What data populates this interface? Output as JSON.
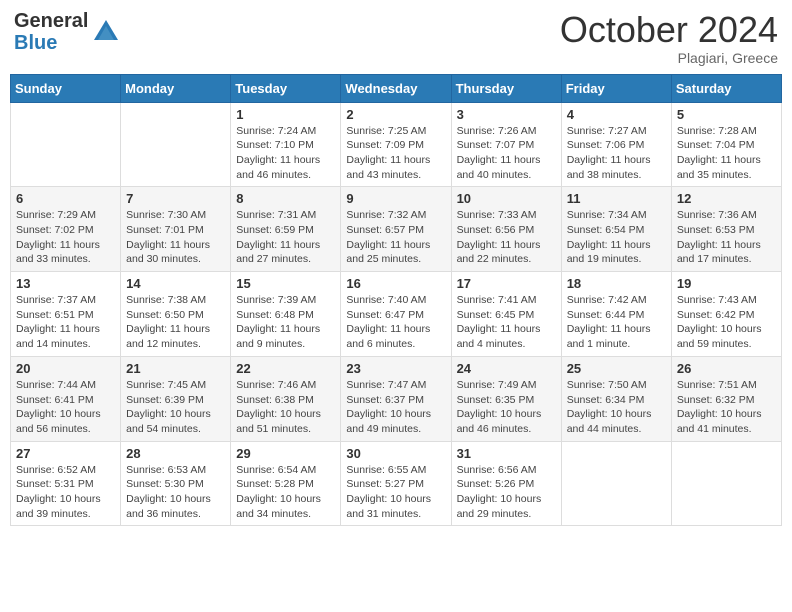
{
  "header": {
    "logo_general": "General",
    "logo_blue": "Blue",
    "month_title": "October 2024",
    "location": "Plagiari, Greece"
  },
  "days_of_week": [
    "Sunday",
    "Monday",
    "Tuesday",
    "Wednesday",
    "Thursday",
    "Friday",
    "Saturday"
  ],
  "weeks": [
    [
      {
        "day": "",
        "info": ""
      },
      {
        "day": "",
        "info": ""
      },
      {
        "day": "1",
        "info": "Sunrise: 7:24 AM\nSunset: 7:10 PM\nDaylight: 11 hours and 46 minutes."
      },
      {
        "day": "2",
        "info": "Sunrise: 7:25 AM\nSunset: 7:09 PM\nDaylight: 11 hours and 43 minutes."
      },
      {
        "day": "3",
        "info": "Sunrise: 7:26 AM\nSunset: 7:07 PM\nDaylight: 11 hours and 40 minutes."
      },
      {
        "day": "4",
        "info": "Sunrise: 7:27 AM\nSunset: 7:06 PM\nDaylight: 11 hours and 38 minutes."
      },
      {
        "day": "5",
        "info": "Sunrise: 7:28 AM\nSunset: 7:04 PM\nDaylight: 11 hours and 35 minutes."
      }
    ],
    [
      {
        "day": "6",
        "info": "Sunrise: 7:29 AM\nSunset: 7:02 PM\nDaylight: 11 hours and 33 minutes."
      },
      {
        "day": "7",
        "info": "Sunrise: 7:30 AM\nSunset: 7:01 PM\nDaylight: 11 hours and 30 minutes."
      },
      {
        "day": "8",
        "info": "Sunrise: 7:31 AM\nSunset: 6:59 PM\nDaylight: 11 hours and 27 minutes."
      },
      {
        "day": "9",
        "info": "Sunrise: 7:32 AM\nSunset: 6:57 PM\nDaylight: 11 hours and 25 minutes."
      },
      {
        "day": "10",
        "info": "Sunrise: 7:33 AM\nSunset: 6:56 PM\nDaylight: 11 hours and 22 minutes."
      },
      {
        "day": "11",
        "info": "Sunrise: 7:34 AM\nSunset: 6:54 PM\nDaylight: 11 hours and 19 minutes."
      },
      {
        "day": "12",
        "info": "Sunrise: 7:36 AM\nSunset: 6:53 PM\nDaylight: 11 hours and 17 minutes."
      }
    ],
    [
      {
        "day": "13",
        "info": "Sunrise: 7:37 AM\nSunset: 6:51 PM\nDaylight: 11 hours and 14 minutes."
      },
      {
        "day": "14",
        "info": "Sunrise: 7:38 AM\nSunset: 6:50 PM\nDaylight: 11 hours and 12 minutes."
      },
      {
        "day": "15",
        "info": "Sunrise: 7:39 AM\nSunset: 6:48 PM\nDaylight: 11 hours and 9 minutes."
      },
      {
        "day": "16",
        "info": "Sunrise: 7:40 AM\nSunset: 6:47 PM\nDaylight: 11 hours and 6 minutes."
      },
      {
        "day": "17",
        "info": "Sunrise: 7:41 AM\nSunset: 6:45 PM\nDaylight: 11 hours and 4 minutes."
      },
      {
        "day": "18",
        "info": "Sunrise: 7:42 AM\nSunset: 6:44 PM\nDaylight: 11 hours and 1 minute."
      },
      {
        "day": "19",
        "info": "Sunrise: 7:43 AM\nSunset: 6:42 PM\nDaylight: 10 hours and 59 minutes."
      }
    ],
    [
      {
        "day": "20",
        "info": "Sunrise: 7:44 AM\nSunset: 6:41 PM\nDaylight: 10 hours and 56 minutes."
      },
      {
        "day": "21",
        "info": "Sunrise: 7:45 AM\nSunset: 6:39 PM\nDaylight: 10 hours and 54 minutes."
      },
      {
        "day": "22",
        "info": "Sunrise: 7:46 AM\nSunset: 6:38 PM\nDaylight: 10 hours and 51 minutes."
      },
      {
        "day": "23",
        "info": "Sunrise: 7:47 AM\nSunset: 6:37 PM\nDaylight: 10 hours and 49 minutes."
      },
      {
        "day": "24",
        "info": "Sunrise: 7:49 AM\nSunset: 6:35 PM\nDaylight: 10 hours and 46 minutes."
      },
      {
        "day": "25",
        "info": "Sunrise: 7:50 AM\nSunset: 6:34 PM\nDaylight: 10 hours and 44 minutes."
      },
      {
        "day": "26",
        "info": "Sunrise: 7:51 AM\nSunset: 6:32 PM\nDaylight: 10 hours and 41 minutes."
      }
    ],
    [
      {
        "day": "27",
        "info": "Sunrise: 6:52 AM\nSunset: 5:31 PM\nDaylight: 10 hours and 39 minutes."
      },
      {
        "day": "28",
        "info": "Sunrise: 6:53 AM\nSunset: 5:30 PM\nDaylight: 10 hours and 36 minutes."
      },
      {
        "day": "29",
        "info": "Sunrise: 6:54 AM\nSunset: 5:28 PM\nDaylight: 10 hours and 34 minutes."
      },
      {
        "day": "30",
        "info": "Sunrise: 6:55 AM\nSunset: 5:27 PM\nDaylight: 10 hours and 31 minutes."
      },
      {
        "day": "31",
        "info": "Sunrise: 6:56 AM\nSunset: 5:26 PM\nDaylight: 10 hours and 29 minutes."
      },
      {
        "day": "",
        "info": ""
      },
      {
        "day": "",
        "info": ""
      }
    ]
  ]
}
